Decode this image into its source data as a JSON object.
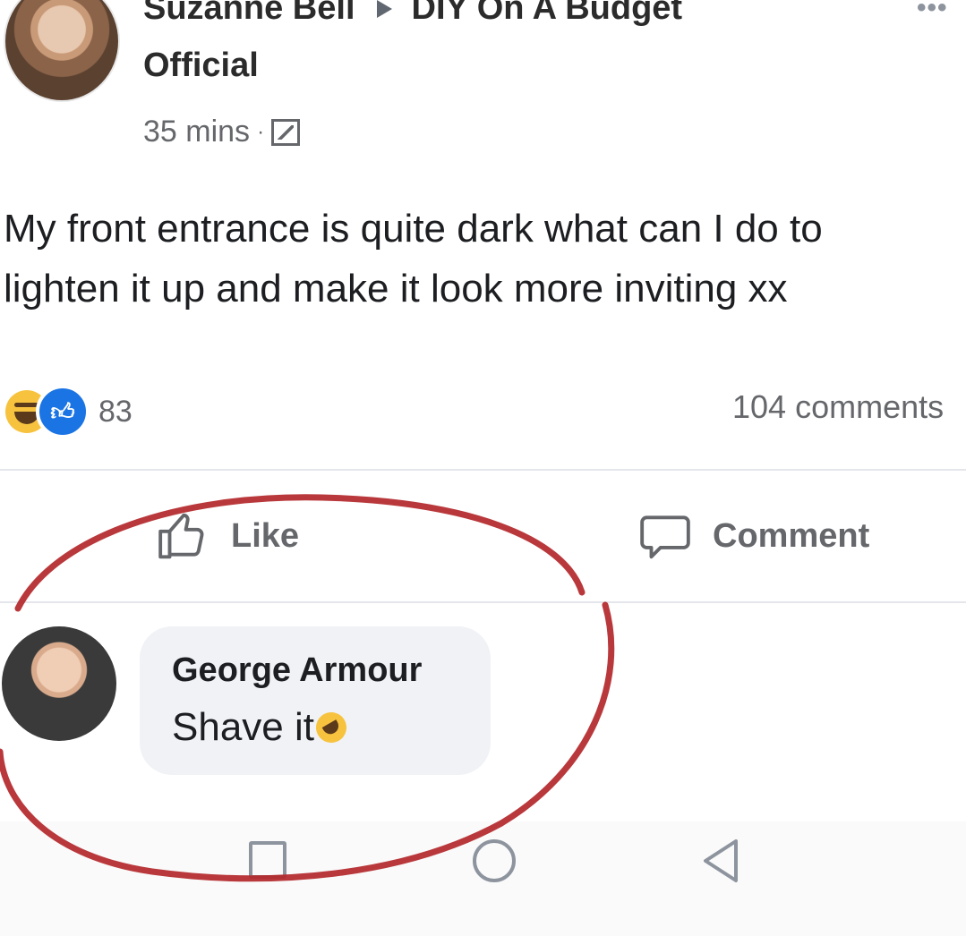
{
  "post": {
    "author": "Suzanne Bell",
    "group": "DIY On A Budget",
    "group_suffix": "Official",
    "time": "35 mins",
    "separator": "·",
    "more_icon": "more-options-icon",
    "privacy_icon": "globe-photo-icon",
    "text": "My front entrance is quite dark what can I do to\nlighten it up and make it look more inviting xx",
    "reactions_count": "83",
    "comments_count": "104 comments",
    "reaction_icons": [
      "haha-icon",
      "like-icon"
    ]
  },
  "actions": {
    "like_label": "Like",
    "comment_label": "Comment"
  },
  "comment": {
    "name": "George Armour",
    "text": "Shave it",
    "emoji_icon": "rofl-icon"
  },
  "annotation": {
    "color": "#b3272a",
    "shape": "hand-drawn circle"
  },
  "navigation": {
    "items": [
      "recent-apps-icon",
      "home-icon",
      "back-icon"
    ]
  },
  "colors": {
    "like_blue": "#1b74e4",
    "secondary_text": "#65676b",
    "bubble_bg": "#f0f2f5"
  }
}
